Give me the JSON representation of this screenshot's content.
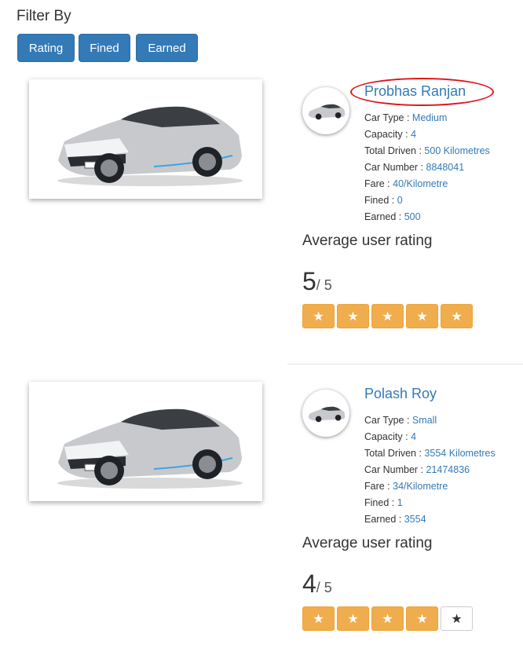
{
  "filter": {
    "title": "Filter By",
    "buttons": [
      "Rating",
      "Fined",
      "Earned"
    ]
  },
  "labels": {
    "car_type": "Car Type",
    "capacity": "Capacity",
    "total_driven": "Total Driven",
    "car_number": "Car Number",
    "fare": "Fare",
    "fined": "Fined",
    "earned": "Earned",
    "avg_rating": "Average user rating",
    "out_of": "/ 5"
  },
  "drivers": [
    {
      "name": "Probhas Ranjan",
      "car_type": "Medium",
      "capacity": "4",
      "total_driven": "500 Kilometres",
      "car_number": "8848041",
      "fare": "40/Kilometre",
      "fined": "0",
      "earned": "500",
      "rating": "5",
      "rating_value": 5
    },
    {
      "name": "Polash Roy",
      "car_type": "Small",
      "capacity": "4",
      "total_driven": "3554 Kilometres",
      "car_number": "21474836",
      "fare": "34/Kilometre",
      "fined": "1",
      "earned": "3554",
      "rating": "4",
      "rating_value": 4
    }
  ],
  "star_glyph": "★",
  "colors": {
    "primary": "#337ab7",
    "star_on": "#f0ad4e",
    "highlight_circle": "#e0131a"
  }
}
